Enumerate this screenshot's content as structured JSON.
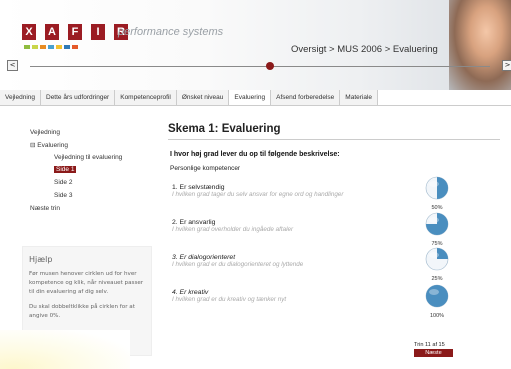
{
  "header": {
    "logo_letters": [
      "X",
      "A",
      "F",
      "I",
      "R"
    ],
    "logo_tagline": "performance systems",
    "logo_dot_colors": [
      "#8fbc3f",
      "#c9d64a",
      "#e88c22",
      "#4aa1cf",
      "#f2c230",
      "#2f7ab6",
      "#e55a2a"
    ],
    "breadcrumb": "Oversigt > MUS 2006 > Evaluering",
    "nav_prev": "<",
    "nav_next": ">"
  },
  "tabs": [
    {
      "label": "Vejledning"
    },
    {
      "label": "Dette års udfordringer"
    },
    {
      "label": "Kompetenceprofil"
    },
    {
      "label": "Ønsket niveau"
    },
    {
      "label": "Evaluering",
      "active": true
    },
    {
      "label": "Afsend forberedelse"
    },
    {
      "label": "Materiale"
    }
  ],
  "sidebar": {
    "items": [
      {
        "label": "Vejledning"
      },
      {
        "label": "⊟ Evaluering"
      },
      {
        "label": "Vejledning til evaluering"
      },
      {
        "label": "Side 1",
        "active": true
      },
      {
        "label": "Side 2"
      },
      {
        "label": "Side 3"
      },
      {
        "label": "Næste trin"
      }
    ]
  },
  "help": {
    "title": "Hjælp",
    "text1": "Før musen henover cirklen ud for hver kompetence og klik, når niveauet passer til din evaluering af dig selv.",
    "text2": "Du skal dobbeltklikke på cirklen for at angive 0%."
  },
  "main": {
    "title": "Skema 1: Evaluering",
    "question": "I hvor høj grad lever du op til følgende beskrivelse:",
    "subhead": "Personlige kompetencer",
    "items": [
      {
        "title": "1. Er selvstændig",
        "desc": "I hvilken grad tager du selv ansvar for egne ord og handlinger",
        "percent_label": "50%",
        "value": 0.5
      },
      {
        "title": "2. Er ansvarlig",
        "desc": "I hvilken grad overholder du ingåede aftaler",
        "percent_label": "75%",
        "value": 0.75
      },
      {
        "title": "3. Er dialogorienteret",
        "desc": "I hvilken grad er du dialogorienteret og lyttende",
        "percent_label": "25%",
        "value": 0.25
      },
      {
        "title": "4. Er kreativ",
        "desc": "I hvilken grad er du kreativ og tænker nyt",
        "percent_label": "100%",
        "value": 1.0
      }
    ],
    "step": "Trin 11 af 15",
    "next": "Næste"
  },
  "colors": {
    "accent": "#8b1a1a",
    "pie_fill": "#4a8ebf",
    "pie_empty": "#f2f6fa"
  }
}
